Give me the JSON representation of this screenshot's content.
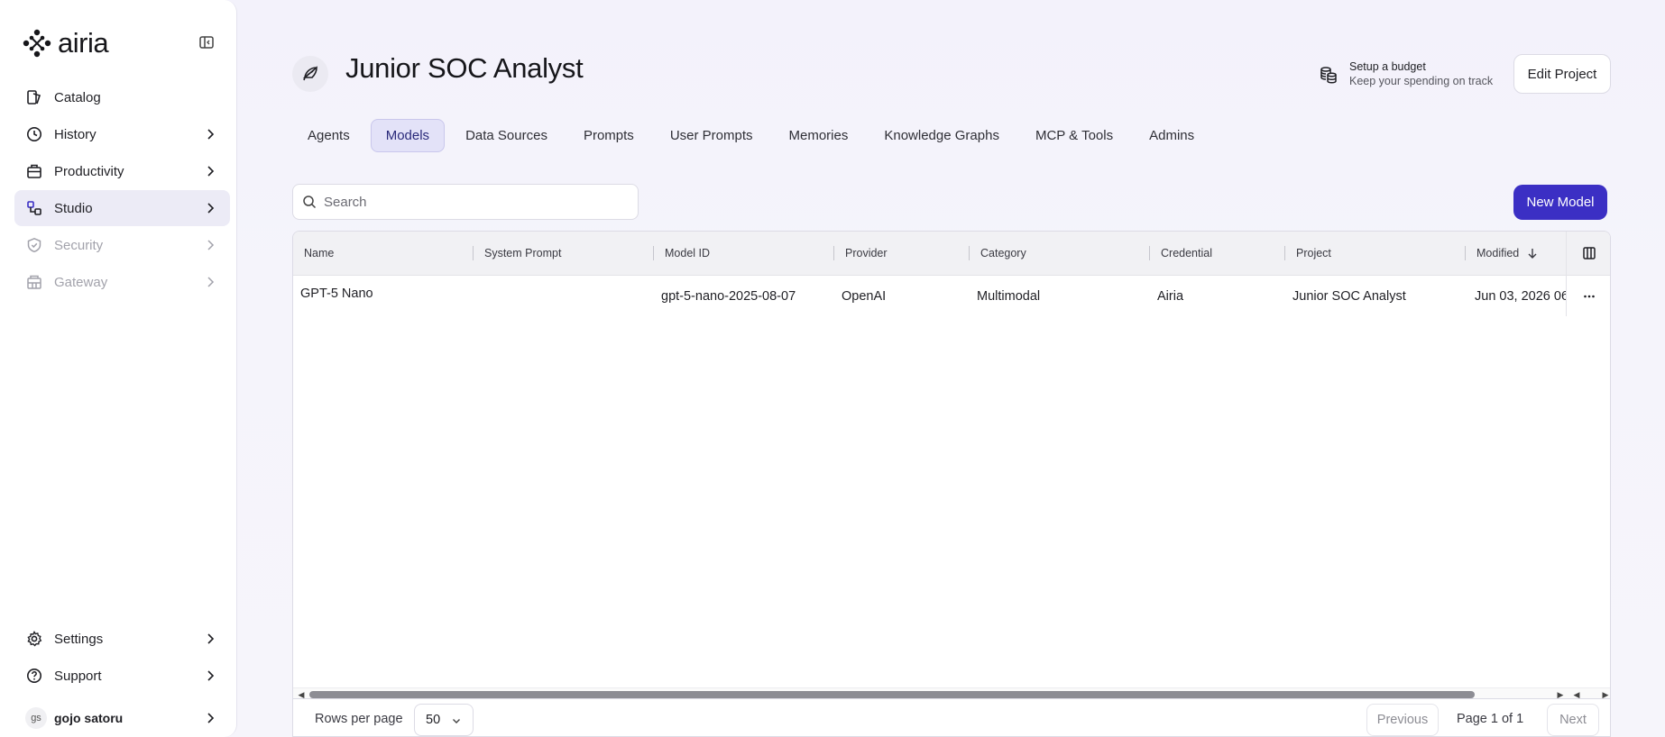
{
  "app": {
    "brand": "airia"
  },
  "sidebar": {
    "items": [
      {
        "label": "Catalog",
        "icon": "catalog-icon",
        "chevron": false,
        "state": "normal"
      },
      {
        "label": "History",
        "icon": "clock-icon",
        "chevron": true,
        "state": "normal"
      },
      {
        "label": "Productivity",
        "icon": "briefcase-icon",
        "chevron": true,
        "state": "normal"
      },
      {
        "label": "Studio",
        "icon": "studio-icon",
        "chevron": true,
        "state": "active"
      },
      {
        "label": "Security",
        "icon": "shield-icon",
        "chevron": true,
        "state": "disabled"
      },
      {
        "label": "Gateway",
        "icon": "gateway-icon",
        "chevron": true,
        "state": "disabled"
      }
    ],
    "bottom": [
      {
        "label": "Settings",
        "icon": "gear-icon"
      },
      {
        "label": "Support",
        "icon": "help-icon"
      }
    ],
    "user": {
      "initials": "gs",
      "name": "gojo satoru"
    }
  },
  "header": {
    "title": "Junior SOC Analyst",
    "budget_title": "Setup a budget",
    "budget_sub": "Keep your spending on track",
    "edit_label": "Edit Project"
  },
  "tabs": [
    {
      "label": "Agents",
      "active": false
    },
    {
      "label": "Models",
      "active": true
    },
    {
      "label": "Data Sources",
      "active": false
    },
    {
      "label": "Prompts",
      "active": false
    },
    {
      "label": "User Prompts",
      "active": false
    },
    {
      "label": "Memories",
      "active": false
    },
    {
      "label": "Knowledge Graphs",
      "active": false
    },
    {
      "label": "MCP & Tools",
      "active": false
    },
    {
      "label": "Admins",
      "active": false
    }
  ],
  "search": {
    "placeholder": "Search"
  },
  "new_button": "New Model",
  "table": {
    "columns": [
      "Name",
      "System Prompt",
      "Model ID",
      "Provider",
      "Category",
      "Credential",
      "Project",
      "Modified"
    ],
    "rows": [
      [
        "GPT-5 Nano",
        "",
        "gpt-5-nano-2025-08-07",
        "OpenAI",
        "Multimodal",
        "Airia",
        "Junior SOC Analyst",
        "Jun 03, 2026 06"
      ]
    ]
  },
  "footer": {
    "rows_per_page_label": "Rows per page",
    "rows_per_page_value": "50",
    "previous": "Previous",
    "page_info": "Page 1 of 1",
    "next": "Next"
  },
  "colors": {
    "accent": "#3b2fc4",
    "active_tab_bg": "#e3e2f8",
    "sidebar_active_bg": "#ecebf6"
  }
}
